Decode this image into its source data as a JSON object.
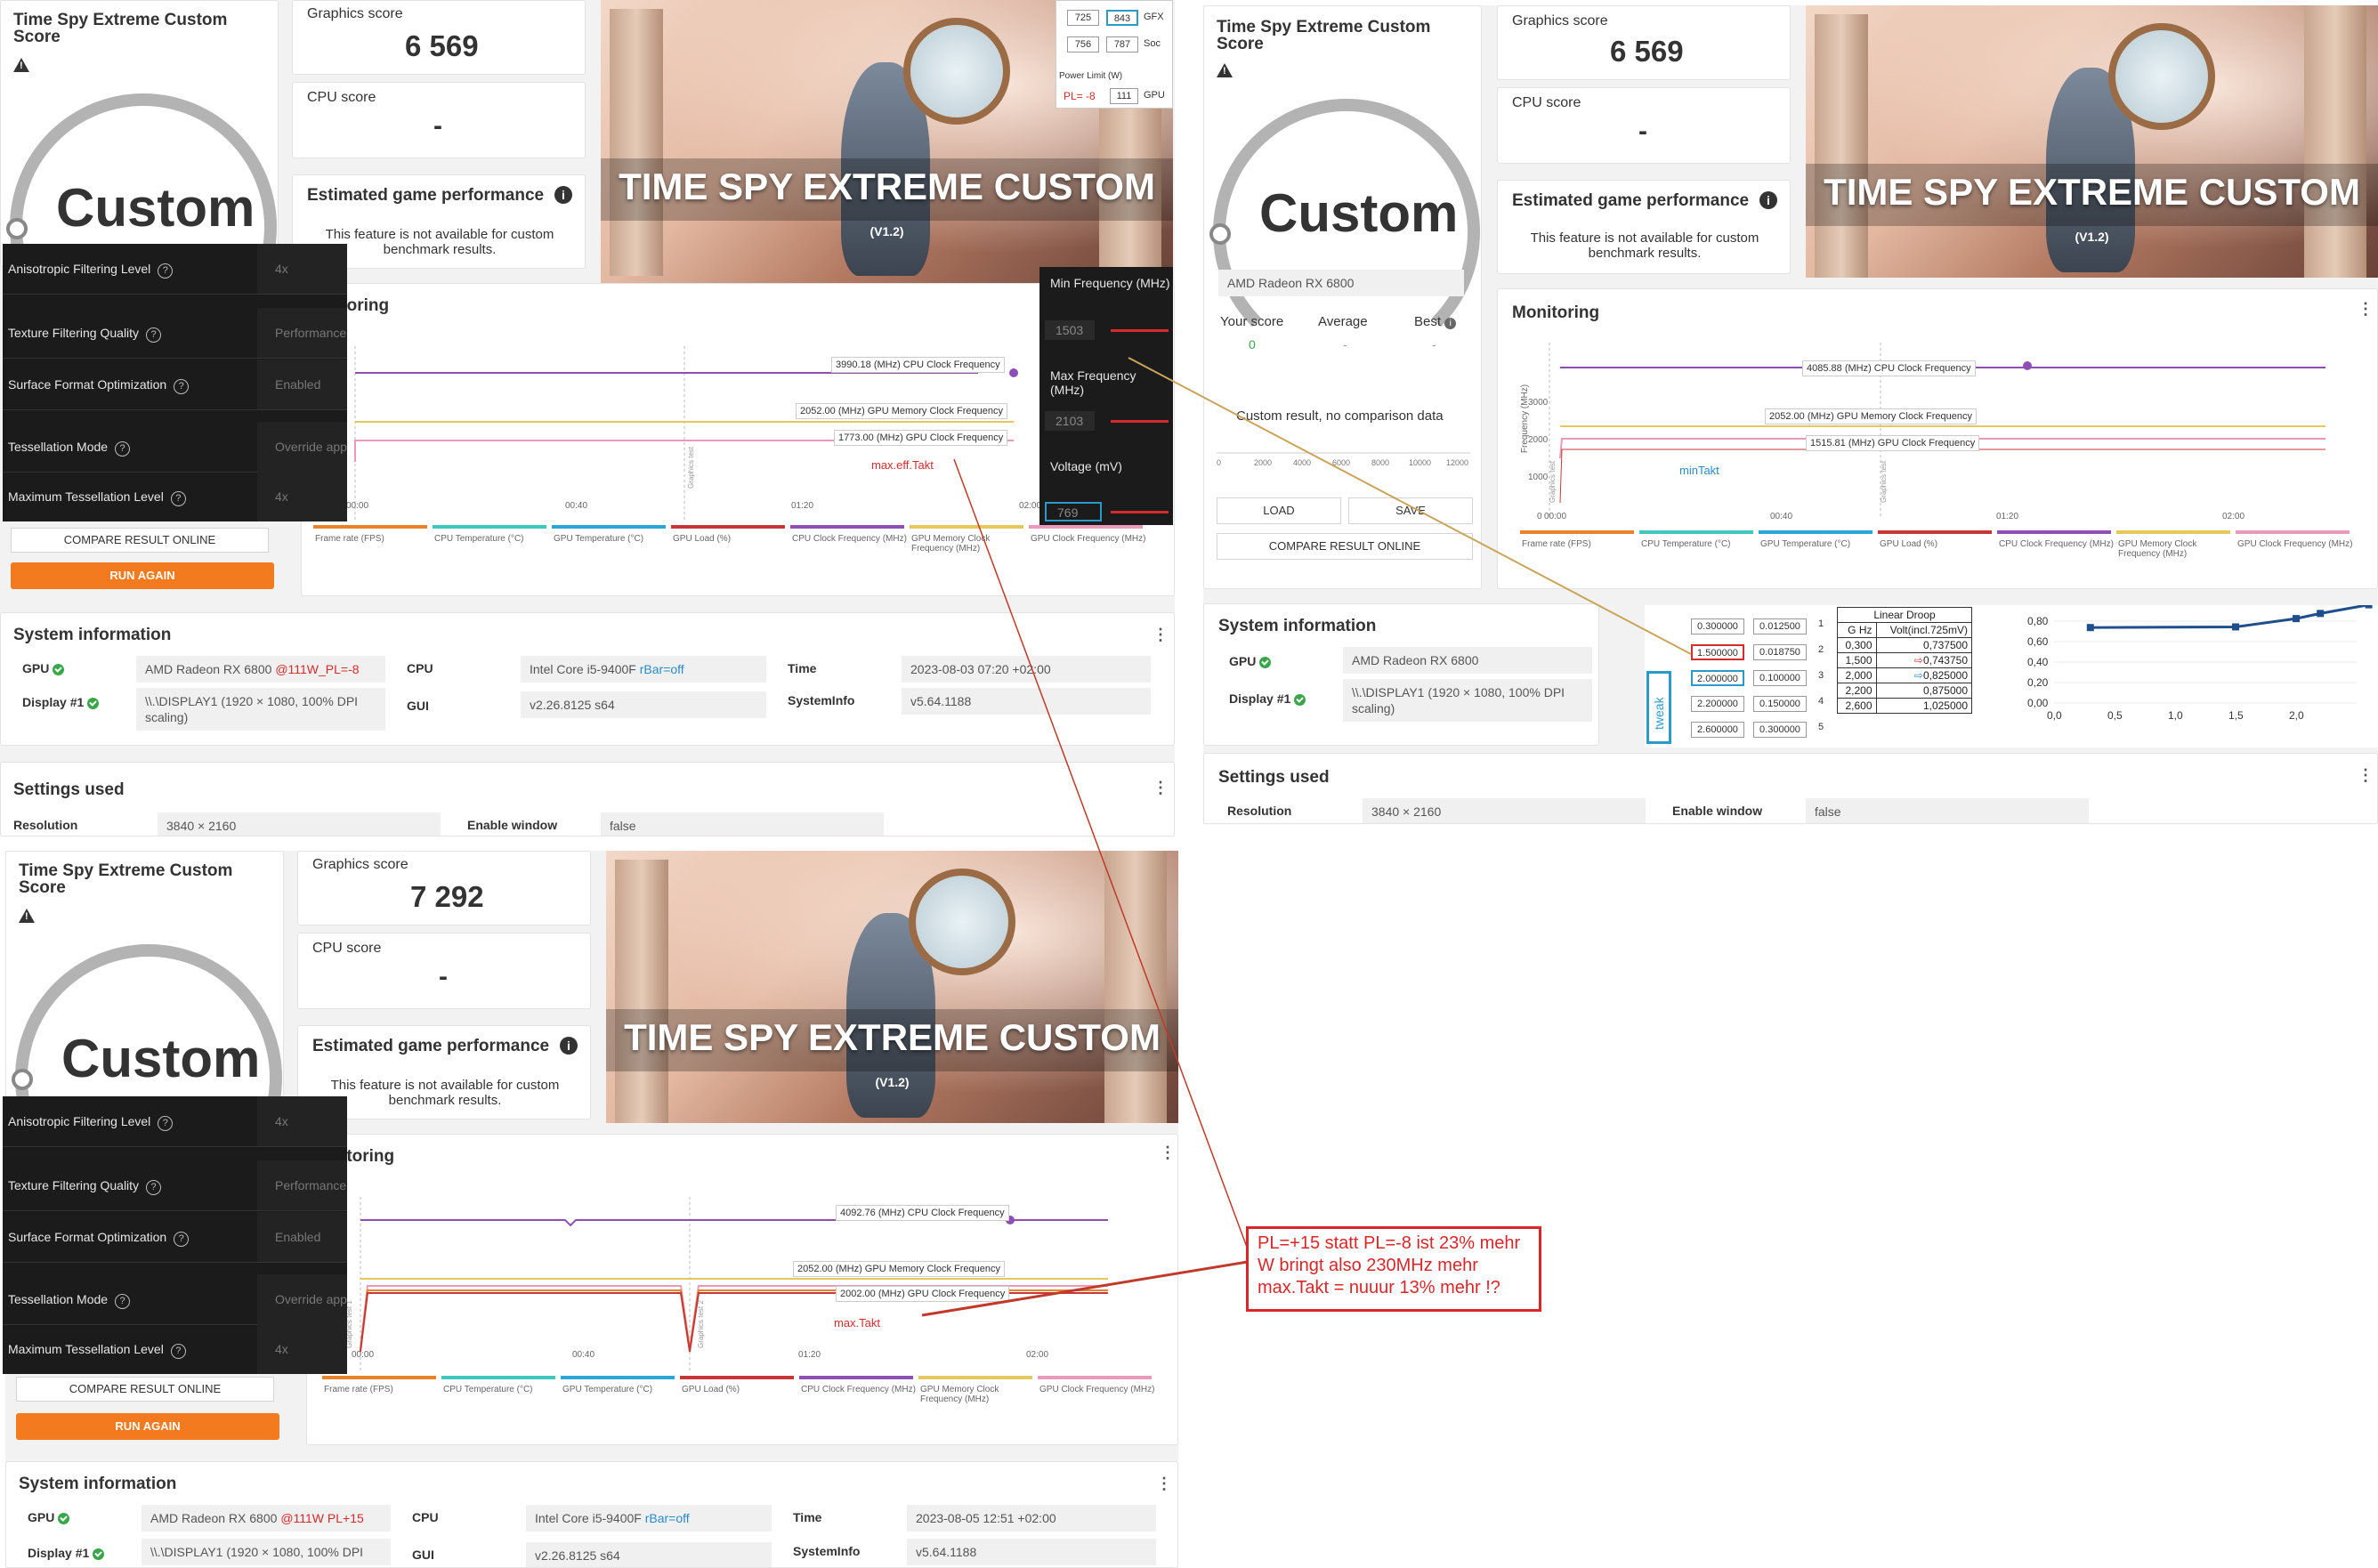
{
  "panels": [
    {
      "score_title": "Time Spy Extreme Custom Score",
      "gauge_label": "Custom",
      "graphics_label": "Graphics score",
      "graphics_value": "6 569",
      "cpu_label": "CPU score",
      "cpu_value": "-",
      "egp_title": "Estimated game performance",
      "egp_note": "This feature is not available for custom benchmark results.",
      "hero_title": "TIME SPY EXTREME CUSTOM",
      "hero_version": "(V1.2)",
      "monitoring": "Monitoring",
      "compare_btn": "COMPARE RESULT ONLINE",
      "run_btn": "RUN AGAIN",
      "lines": {
        "cpu": "3990.18 (MHz) CPU Clock Frequency",
        "mem": "2052.00 (MHz) GPU Memory Clock Frequency",
        "gpu": "1773.00 (MHz) GPU Clock Frequency"
      },
      "chart_note": "max.eff.Takt",
      "sysinfo": {
        "title": "System information",
        "gpu_k": "GPU",
        "gpu_v": "AMD Radeon RX 6800",
        "gpu_extra": "@111W_PL=-8",
        "display_k": "Display #1",
        "display_v": "\\\\.\\DISPLAY1 (1920 × 1080, 100% DPI scaling)",
        "cpu_k": "CPU",
        "cpu_v": "Intel Core i5-9400F",
        "cpu_extra": "rBar=off",
        "gui_k": "GUI",
        "gui_v": "v2.26.8125 s64",
        "time_k": "Time",
        "time_v": "2023-08-03 07:20 +02:00",
        "si_k": "SystemInfo",
        "si_v": "v5.64.1188"
      },
      "settings": {
        "title": "Settings used",
        "res_k": "Resolution",
        "res_v": "3840 × 2160",
        "win_k": "Enable window",
        "win_v": "false"
      }
    },
    {
      "score_title": "Time Spy Extreme Custom Score",
      "gauge_label": "Custom",
      "graphics_label": "Graphics score",
      "graphics_value": "7 292",
      "cpu_label": "CPU score",
      "cpu_value": "-",
      "egp_title": "Estimated game performance",
      "egp_note": "This feature is not available for custom benchmark results.",
      "hero_title": "TIME SPY EXTREME CUSTOM",
      "hero_version": "(V1.2)",
      "monitoring": "Monitoring",
      "compare_btn": "COMPARE RESULT ONLINE",
      "run_btn": "RUN AGAIN",
      "lines": {
        "cpu": "4092.76 (MHz) CPU Clock Frequency",
        "mem": "2052.00 (MHz) GPU Memory Clock Frequency",
        "gpu": "2002.00 (MHz) GPU Clock Frequency"
      },
      "chart_note": "max.Takt",
      "sysinfo": {
        "title": "System information",
        "gpu_k": "GPU",
        "gpu_v": "AMD Radeon RX 6800",
        "gpu_extra": "@111W PL+15",
        "display_k": "Display #1",
        "display_v": "\\\\.\\DISPLAY1 (1920 × 1080, 100% DPI",
        "cpu_k": "CPU",
        "cpu_v": "Intel Core i5-9400F",
        "cpu_extra": "rBar=off",
        "gui_k": "GUI",
        "gui_v": "v2.26.8125 s64",
        "time_k": "Time",
        "time_v": "2023-08-05 12:51 +02:00",
        "si_k": "SystemInfo",
        "si_v": "v5.64.1188"
      }
    },
    {
      "score_title": "Time Spy Extreme Custom Score",
      "gauge_label": "Custom",
      "graphics_label": "Graphics score",
      "graphics_value": "6 569",
      "cpu_label": "CPU score",
      "cpu_value": "-",
      "egp_title": "Estimated game performance",
      "egp_note": "This feature is not available for custom benchmark results.",
      "hero_title": "TIME SPY EXTREME CUSTOM",
      "hero_version": "(V1.2)",
      "monitoring": "Monitoring",
      "gpu_name": "AMD Radeon RX 6800",
      "your_score": "Your score",
      "your_val": "0",
      "average": "Average",
      "avg_val": "-",
      "best": "Best",
      "best_val": "-",
      "no_comp": "Custom result, no comparison data",
      "load_btn": "LOAD",
      "save_btn": "SAVE",
      "compare_btn": "COMPARE RESULT ONLINE",
      "lines": {
        "cpu": "4085.88 (MHz) CPU Clock Frequency",
        "mem": "2052.00 (MHz) GPU Memory Clock Frequency",
        "gpu": "1515.81 (MHz) GPU Clock Frequency"
      },
      "chart_note": "minTakt",
      "ylabel": "Frequency (MHz)",
      "sysinfo": {
        "title": "System information",
        "gpu_k": "GPU",
        "gpu_v": "AMD Radeon RX 6800",
        "display_k": "Display #1",
        "display_v": "\\\\.\\DISPLAY1 (1920 × 1080, 100% DPI scaling)"
      },
      "settings": {
        "title": "Settings used",
        "res_k": "Resolution",
        "res_v": "3840 × 2160",
        "win_k": "Enable window",
        "win_v": "false"
      }
    }
  ],
  "dark_settings": [
    {
      "label": "Anisotropic Filtering Level",
      "value": "4x"
    },
    {
      "label": "Texture Filtering Quality",
      "value": "Performance"
    },
    {
      "label": "Surface Format Optimization",
      "value": "Enabled"
    },
    {
      "label": "Tessellation Mode",
      "value": "Override application settings"
    },
    {
      "label": "Maximum Tessellation Level",
      "value": "4x"
    }
  ],
  "freq_panel": {
    "min_label": "Min Frequency (MHz)",
    "min_val": "1503",
    "max_label": "Max Frequency (MHz)",
    "max_val": "2103",
    "volt_label": "Voltage (mV)",
    "volt_val": "769"
  },
  "power_panel": {
    "a": "725",
    "b": "843",
    "gfx": "GFX",
    "c": "756",
    "d": "787",
    "soc": "Soc",
    "pl_label": "Power Limit (W)",
    "pl_val": "PL= -8",
    "pl_num": "111",
    "gpu": "GPU"
  },
  "legend": [
    "Frame rate (FPS)",
    "CPU Temperature (°C)",
    "GPU Temperature (°C)",
    "GPU Load (%)",
    "CPU Clock Frequency (MHz)",
    "GPU Memory Clock Frequency (MHz)",
    "GPU Clock Frequency (MHz)"
  ],
  "legend_colors": [
    "#e8832a",
    "#3dc8c0",
    "#2aa7d8",
    "#c83737",
    "#8e4fb5",
    "#e6c85a",
    "#e89ab8"
  ],
  "time_ticks": [
    "00:00",
    "00:40",
    "01:20",
    "02:00"
  ],
  "vf_table": {
    "title": "Linear Droop",
    "h1": "G Hz",
    "h2": "Volt(incl.725mV)",
    "rows": [
      [
        "0,300",
        "0,737500"
      ],
      [
        "1,500",
        "0,743750"
      ],
      [
        "2,000",
        "0,825000"
      ],
      [
        "2,200",
        "0,875000"
      ],
      [
        "2,600",
        "1,025000"
      ]
    ],
    "boxes": [
      [
        "0.300000",
        "0.012500",
        "1"
      ],
      [
        "1.500000",
        "0.018750",
        "2"
      ],
      [
        "2.000000",
        "0.100000",
        "3"
      ],
      [
        "2.200000",
        "0.150000",
        "4"
      ],
      [
        "2.600000",
        "0.300000",
        "5"
      ]
    ],
    "tweak": "tweak"
  },
  "vf_chart": {
    "type": "line",
    "x": [
      0.3,
      1.5,
      2.0,
      2.2,
      2.6
    ],
    "y": [
      0.7375,
      0.74375,
      0.825,
      0.875,
      1.025
    ],
    "xticks": [
      "0,0",
      "0,5",
      "1,0",
      "1,5",
      "2,0"
    ],
    "yticks": [
      "0,80",
      "0,60",
      "0,40",
      "0,20",
      "0,00"
    ],
    "xlim": [
      0,
      2.5
    ],
    "ylim": [
      0,
      0.8
    ]
  },
  "annotation": "PL=+15 statt PL=-8 ist 23% mehr W bringt also 230MHz mehr max.Takt = nuuur 13% mehr !?",
  "chart_data": [
    {
      "type": "line",
      "title": "Monitoring",
      "x": [
        "00:00",
        "00:40",
        "01:20",
        "02:00"
      ],
      "series": [
        {
          "name": "CPU Clock Frequency (MHz)",
          "values": [
            3990.18
          ]
        },
        {
          "name": "GPU Memory Clock Frequency (MHz)",
          "values": [
            2052.0
          ]
        },
        {
          "name": "GPU Clock Frequency (MHz)",
          "values": [
            1773.0
          ]
        }
      ]
    },
    {
      "type": "line",
      "title": "Monitoring",
      "x": [
        "00:00",
        "00:40",
        "01:20",
        "02:00"
      ],
      "series": [
        {
          "name": "CPU Clock Frequency (MHz)",
          "values": [
            4092.76
          ]
        },
        {
          "name": "GPU Memory Clock Frequency (MHz)",
          "values": [
            2052.0
          ]
        },
        {
          "name": "GPU Clock Frequency (MHz)",
          "values": [
            2002.0
          ]
        }
      ]
    },
    {
      "type": "line",
      "title": "Monitoring",
      "ylabel": "Frequency (MHz)",
      "yticks": [
        "0",
        "1000",
        "2000",
        "3000"
      ],
      "x": [
        "00:00",
        "00:40",
        "01:20",
        "02:00"
      ],
      "series": [
        {
          "name": "CPU Clock Frequency (MHz)",
          "values": [
            4085.88
          ]
        },
        {
          "name": "GPU Memory Clock Frequency (MHz)",
          "values": [
            2052.0
          ]
        },
        {
          "name": "GPU Clock Frequency (MHz)",
          "values": [
            1515.81
          ]
        }
      ]
    }
  ]
}
